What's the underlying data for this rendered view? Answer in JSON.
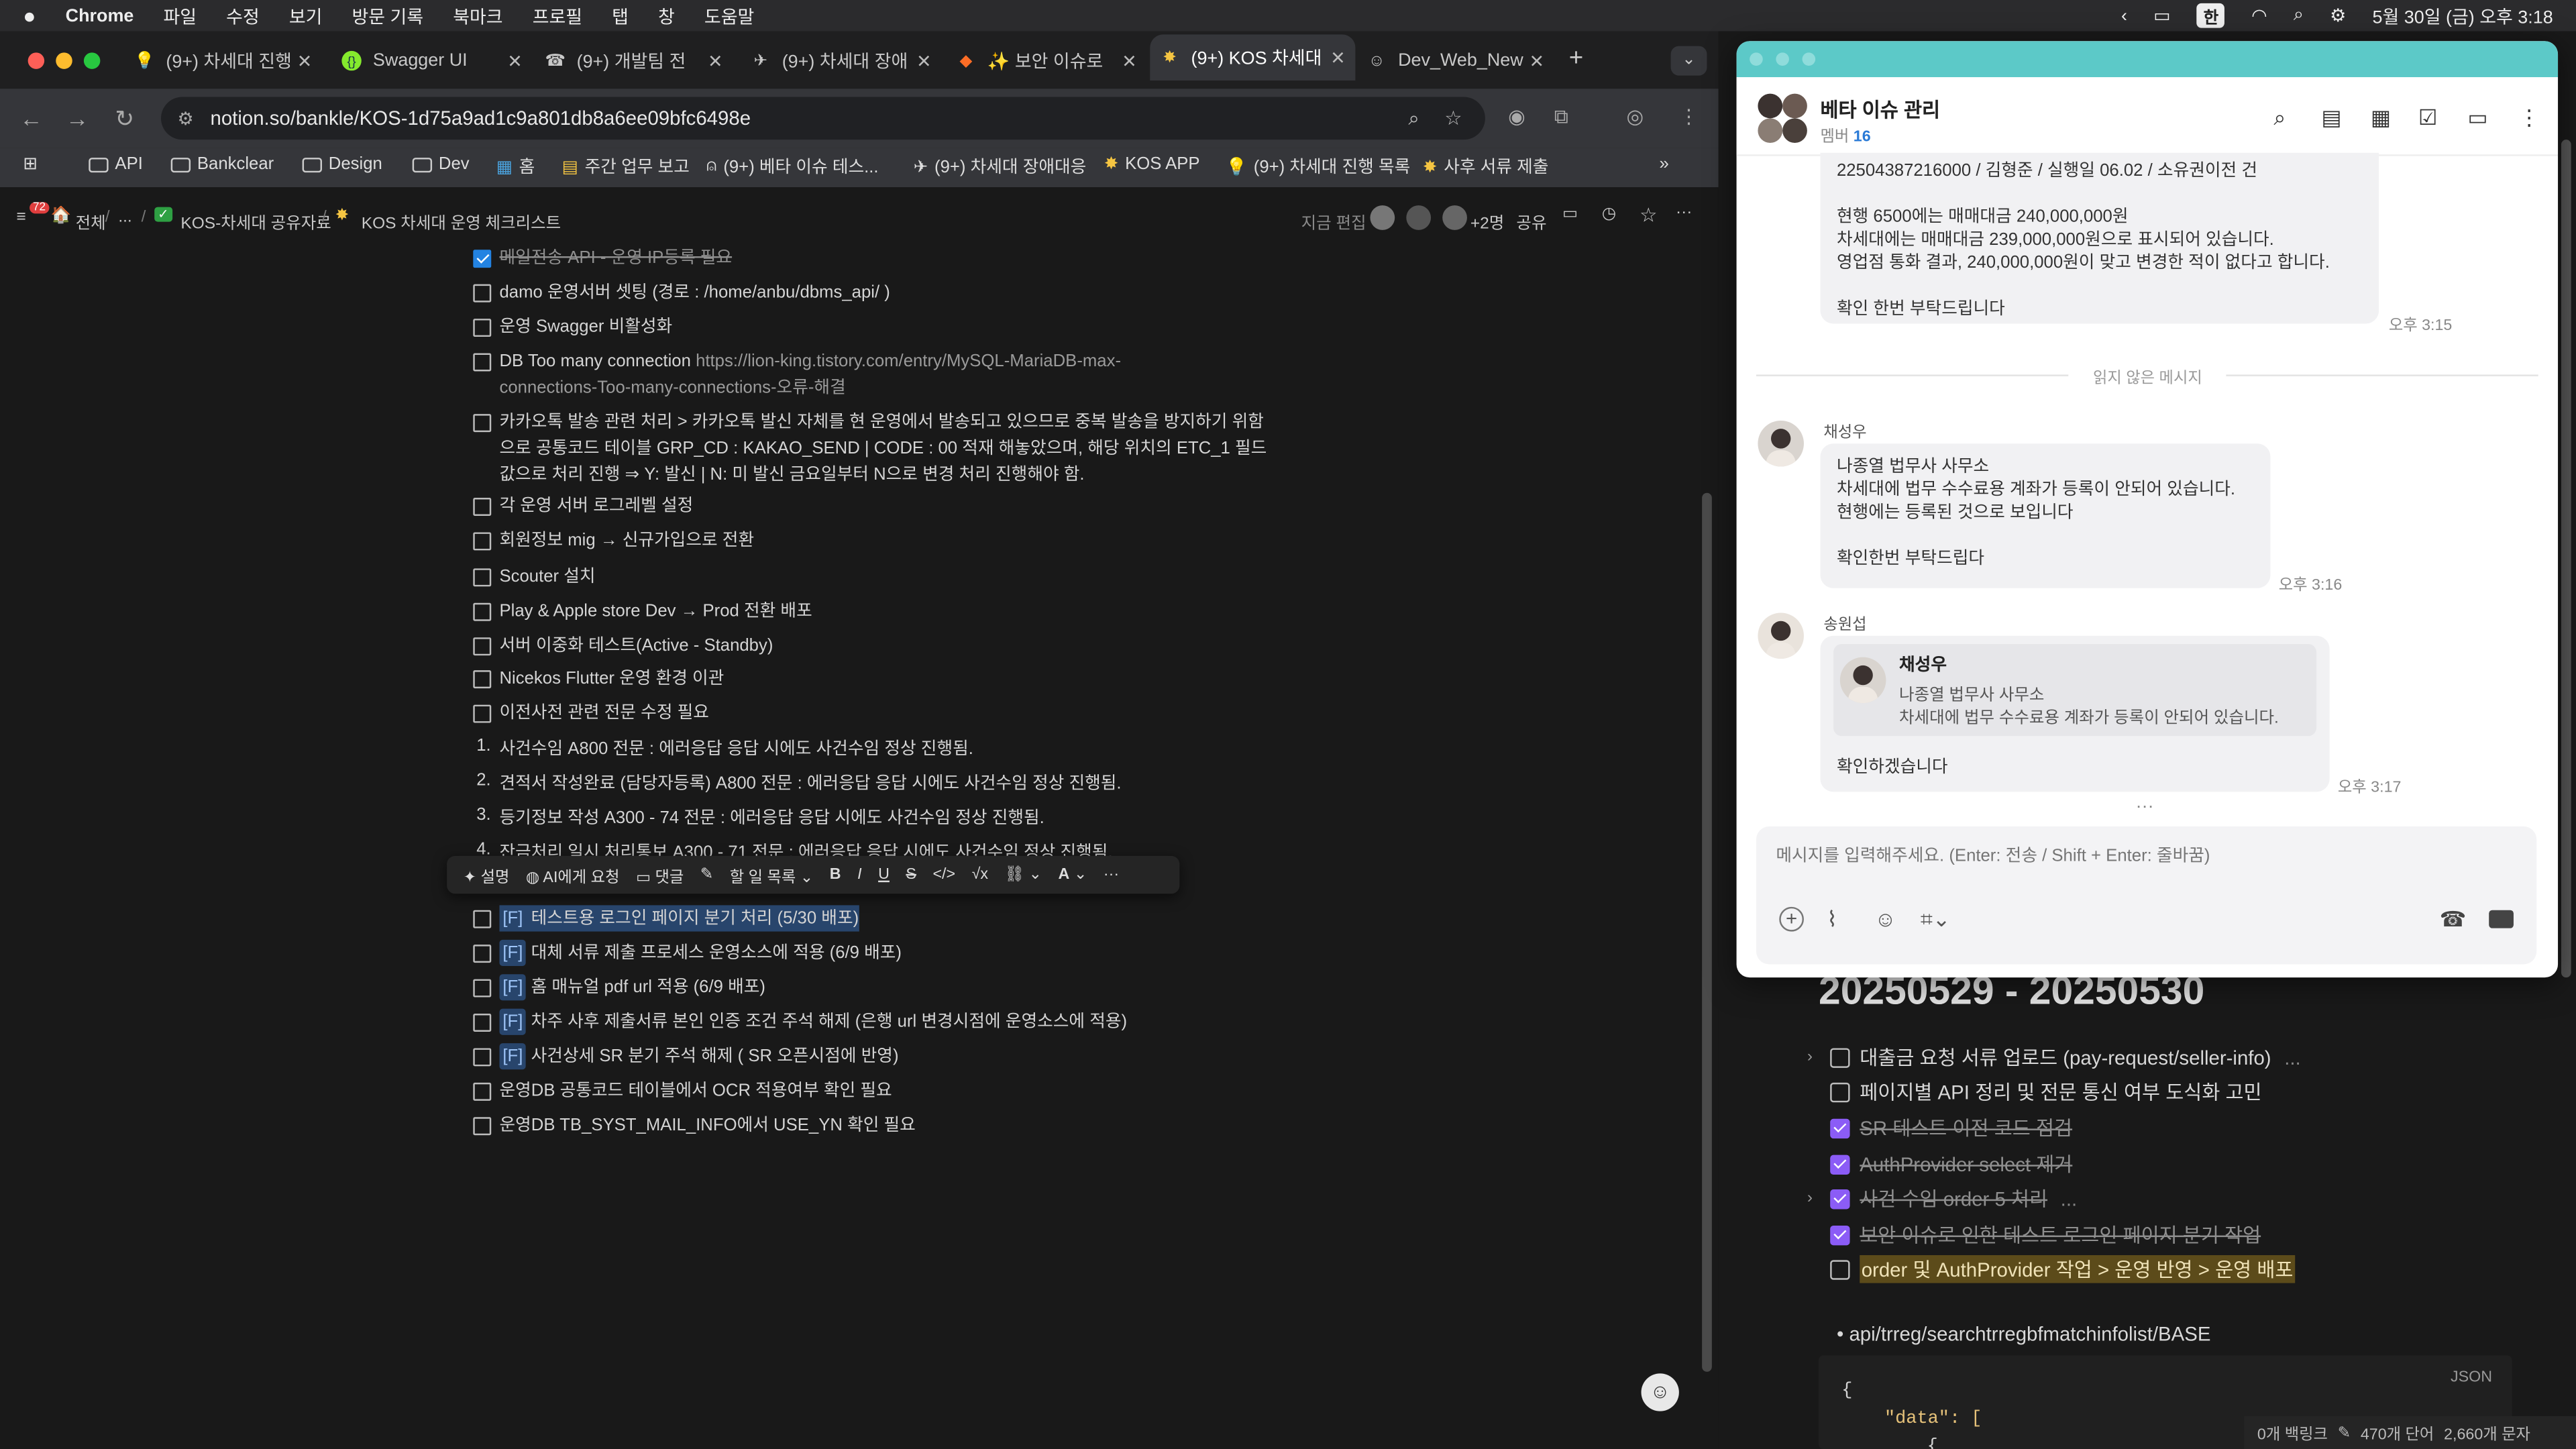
{
  "menubar": {
    "apple": "",
    "app": "Chrome",
    "items": [
      "파일",
      "수정",
      "보기",
      "방문 기록",
      "북마크",
      "프로필",
      "탭",
      "창",
      "도움말"
    ],
    "input_method": "한",
    "datetime": "5월 30일 (금) 오후 3:18"
  },
  "tabs": [
    {
      "label": "(9+) 차세대 진행",
      "icon": "lightbulb-icon"
    },
    {
      "label": "Swagger UI",
      "icon": "swagger-icon"
    },
    {
      "label": "(9+) 개발팀 전",
      "icon": "phone-icon"
    },
    {
      "label": "(9+) 차세대 장애",
      "icon": "plane-icon"
    },
    {
      "label": "✨ 보안 이슈로",
      "icon": "gitlab-icon"
    },
    {
      "label": "(9+) KOS 차세대",
      "icon": "star-badge-icon"
    },
    {
      "label": "Dev_Web_New",
      "icon": "avatar-icon"
    }
  ],
  "address": {
    "url": "notion.so/bankle/KOS-1d75a9ad1c9a801db8a6ee09bfc6498e"
  },
  "bookmarks": [
    {
      "label": "API",
      "icon": "folder-icon"
    },
    {
      "label": "Bankclear",
      "icon": "folder-icon"
    },
    {
      "label": "Design",
      "icon": "folder-icon"
    },
    {
      "label": "Dev",
      "icon": "folder-icon"
    },
    {
      "label": "홈",
      "icon": "notion-icon"
    },
    {
      "label": "주간 업무 보고",
      "icon": "notion-icon"
    },
    {
      "label": "(9+) 베타 이슈 테스...",
      "icon": "person-icon"
    },
    {
      "label": "(9+) 차세대 장애대응",
      "icon": "plane-icon"
    },
    {
      "label": "KOS APP",
      "icon": "star-badge-icon"
    },
    {
      "label": "(9+) 차세대 진행 목록",
      "icon": "lightbulb-icon"
    },
    {
      "label": "사후 서류 제출",
      "icon": "star-badge-icon"
    }
  ],
  "notion_top": {
    "badge": "72",
    "breadcrumb": [
      "전체",
      "...",
      "KOS-차세대 공유자료",
      "KOS 차세대 운영 체크리스트"
    ],
    "edit_status": "지금 편집",
    "extra_count": "+2명",
    "share": "공유"
  },
  "checklist_top": [
    {
      "checked": true,
      "text": "메일전송 API - 운영 IP등록 필요"
    },
    {
      "checked": false,
      "text": "damo 운영서버 셋팅 (경로 : /home/anbu/dbms_api/ )"
    },
    {
      "checked": false,
      "text": "운영 Swagger 비활성화"
    },
    {
      "checked": false,
      "text": "DB Too many connection",
      "link": "https://lion-king.tistory.com/entry/MySQL-MariaDB-max-",
      "link2": "connections-Too-many-connections-오류-해결"
    },
    {
      "checked": false,
      "lines": [
        "카카오톡 발송 관련 처리 > 카카오톡 발신 자체를 현 운영에서 발송되고 있으므로 중복 발송을 방지하기 위함",
        "으로 공통코드 테이블 GRP_CD : KAKAO_SEND | CODE : 00 적재 해놓았으며, 해당 위치의 ETC_1 필드",
        "값으로 처리 진행 ⇒ Y: 발신 | N: 미 발신 금요일부터 N으로 변경 처리 진행해야 함."
      ]
    },
    {
      "checked": false,
      "text": "각 운영 서버 로그레벨 설정"
    },
    {
      "checked": false,
      "text": "회원정보 mig → 신규가입으로 전환"
    },
    {
      "checked": false,
      "text": "Scouter 설치"
    },
    {
      "checked": false,
      "text": "Play & Apple store Dev → Prod 전환 배포"
    },
    {
      "checked": false,
      "text": "서버 이중화 테스트(Active - Standby)"
    },
    {
      "checked": false,
      "text": "Nicekos Flutter 운영 환경 이관"
    },
    {
      "checked": false,
      "text": "이전사전 관련 전문 수정 필요"
    }
  ],
  "numbered": [
    {
      "n": "1.",
      "text": "사건수임 A800 전문 : 에러응답 응답 시에도 사건수임 정상 진행됨."
    },
    {
      "n": "2.",
      "text": "견적서 작성완료 (담당자등록) A800 전문 : 에러응답 응답 시에도 사건수임 정상 진행됨."
    },
    {
      "n": "3.",
      "text": "등기정보 작성 A300 - 74 전문 :  에러응답 응답 시에도 사건수임 정상 진행됨."
    },
    {
      "n": "4.",
      "text": "잔금처리 일시 처리통보 A300 - 71 전문 :  에러응답 응답 시에도 사건수임 정상 진행됨."
    }
  ],
  "toolbar": {
    "explain": "설명",
    "ask_ai": "AI에게 요청",
    "comment": "댓글",
    "todo_list": "할 일 목록",
    "bold": "B",
    "italic": "I",
    "underline": "U",
    "strike": "S",
    "code": "</>",
    "math": "√x",
    "color": "A",
    "more": "···"
  },
  "checklist_bottom": [
    {
      "tag": "[F]",
      "text": "테스트용 로그인 페이지 분기 처리 (5/30 배포)",
      "highlight": true
    },
    {
      "tag": "[F]",
      "text": "대체 서류 제출 프로세스 운영소스에 적용 (6/9 배포)"
    },
    {
      "tag": "[F]",
      "text": "홈 매뉴얼 pdf url 적용 (6/9 배포)"
    },
    {
      "tag": "[F]",
      "text": "차주 사후 제출서류 본인 인증 조건 주석 해제 (은행 url 변경시점에 운영소스에 적용)"
    },
    {
      "tag": "[F]",
      "text": "사건상세 SR 분기 주석 해제 ( SR 오픈시점에 반영)"
    },
    {
      "tag": "",
      "text": "운영DB 공통코드 테이블에서 OCR 적용여부 확인 필요"
    },
    {
      "tag": "",
      "text": "운영DB TB_SYST_MAIL_INFO에서 USE_YN 확인 필요"
    }
  ],
  "right_page": {
    "heading": "20250529 - 20250530",
    "items": [
      {
        "checked": false,
        "toggle": true,
        "text": "대출금 요청 서류 업로드 (pay-request/seller-info)",
        "suffix": "..."
      },
      {
        "checked": false,
        "toggle": false,
        "text": "페이지별 API 정리 및 전문 통신 여부 도식화 고민"
      },
      {
        "checked": true,
        "toggle": false,
        "text": "SR 테스트 이전 코드 점검"
      },
      {
        "checked": true,
        "toggle": false,
        "text": "AuthProvider select 제거"
      },
      {
        "checked": true,
        "toggle": true,
        "text": "사건 수임 order 5 처리",
        "suffix": "..."
      },
      {
        "checked": true,
        "toggle": false,
        "text": "보안 이슈로 인한 테스트 로그인 페이지 분기 작업"
      },
      {
        "checked": false,
        "toggle": false,
        "text": "order 및 AuthProvider 작업 > 운영 반영 > 운영 배포",
        "highlight": true
      }
    ],
    "bullet": "api/trreg/searchtrregbfmatchinfolist/BASE",
    "code_lang": "JSON",
    "code_l1": "{",
    "code_l2": "\"data\": [",
    "code_l3": "{",
    "status": "0개 백링크",
    "words": "470개 단어",
    "chars": "2,660개 문자"
  },
  "chat": {
    "title": "베타 이슈 관리",
    "members_label": "멤버",
    "members_count": "16",
    "msg0_lines": [
      "22504387216000 / 김형준 / 실행일 06.02 / 소유권이전 건",
      "",
      "현행 6500에는 매매대금 240,000,000원",
      "차세대에는 매매대금 239,000,000원으로 표시되어 있습니다.",
      "영업점 통화 결과, 240,000,000원이 맞고 변경한 적이 없다고 합니다.",
      "",
      "확인 한번 부탁드립니다"
    ],
    "msg0_time": "오후 3:15",
    "unread_divider": "읽지 않은 메시지",
    "msg1_sender": "채성우",
    "msg1_lines": [
      "나종열 법무사 사무소",
      "차세대에 법무 수수료용 계좌가 등록이 안되어 있습니다.",
      "현행에는 등록된 것으로 보입니다",
      "",
      "확인한번 부탁드립다"
    ],
    "msg1_time": "오후 3:16",
    "msg2_sender": "송원섭",
    "quote_sender": "채성우",
    "quote_line1": "나종열 법무사 사무소",
    "quote_line2": "차세대에 법무 수수료용 계좌가 등록이 안되어 있습니다.",
    "msg2_text": "확인하겠습니다",
    "msg2_time": "오후 3:17",
    "input_placeholder": "메시지를 입력해주세요. (Enter: 전송 / Shift + Enter: 줄바꿈)"
  },
  "colors": {
    "accent": "#2383e2",
    "chat_titlebar": "#5cc9c8",
    "highlight": "#28456c"
  }
}
